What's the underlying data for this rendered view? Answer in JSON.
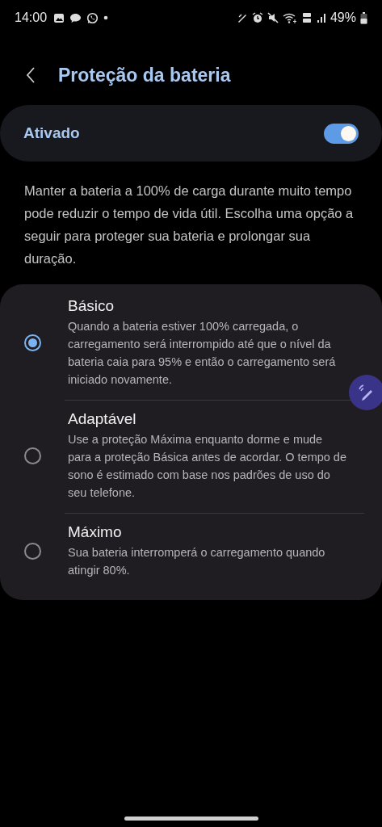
{
  "status_bar": {
    "time": "14:00",
    "battery": "49%"
  },
  "header": {
    "title": "Proteção da bateria"
  },
  "master_switch": {
    "label": "Ativado",
    "on": true
  },
  "description": "Manter a bateria a 100% de carga durante muito tempo pode reduzir o tempo de vida útil. Escolha uma opção a seguir para proteger sua bateria e prolongar sua duração.",
  "options": [
    {
      "title": "Básico",
      "description": "Quando a bateria estiver 100% carregada, o carregamento será interrompido até que o nível da bateria caia para 95% e então o carregamento será iniciado novamente.",
      "selected": true
    },
    {
      "title": "Adaptável",
      "description": "Use a proteção Máxima enquanto dorme e mude para a proteção Básica antes de acordar. O tempo de sono é estimado com base nos padrões de uso do seu telefone.",
      "selected": false
    },
    {
      "title": "Máximo",
      "description": "Sua bateria interromperá o carregamento quando atingir 80%.",
      "selected": false
    }
  ]
}
